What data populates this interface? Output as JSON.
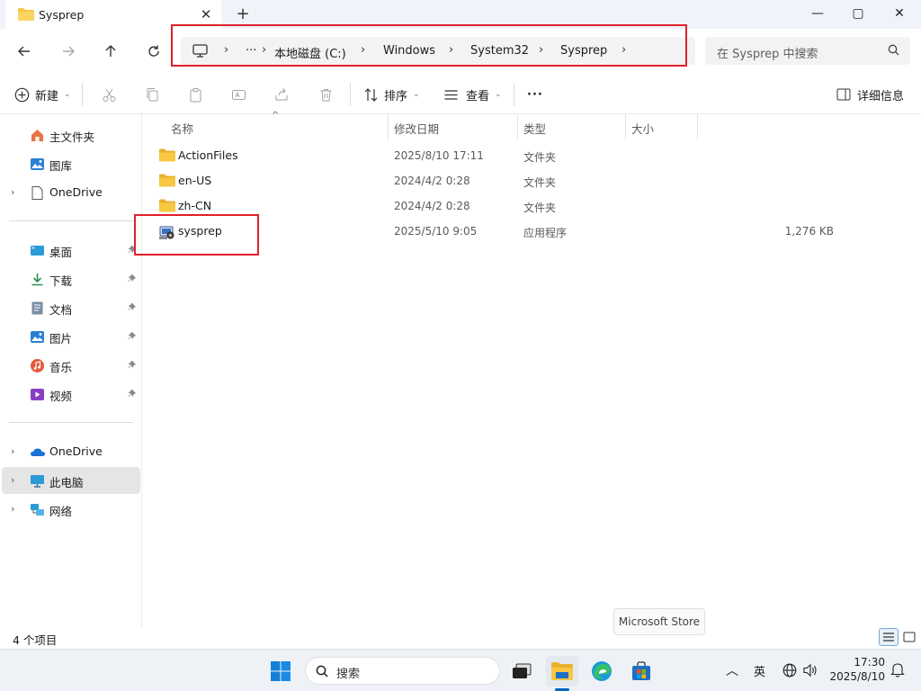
{
  "window": {
    "tab_title": "Sysprep",
    "new_tab_label": "+",
    "controls": {
      "minimize": "—",
      "maximize": "▢",
      "close": "✕"
    }
  },
  "address_bar": {
    "overflow": "···",
    "crumbs": [
      "本地磁盘 (C:)",
      "Windows",
      "System32",
      "Sysprep"
    ],
    "separator": "›"
  },
  "search": {
    "placeholder": "在 Sysprep 中搜索"
  },
  "command_bar": {
    "new_label": "新建",
    "sort_label": "排序",
    "view_label": "查看",
    "more_label": "···",
    "details_label": "详细信息"
  },
  "sidebar": {
    "home": "主文件夹",
    "gallery": "图库",
    "onedrive_top": "OneDrive",
    "quick_access": [
      "桌面",
      "下载",
      "文档",
      "图片",
      "音乐",
      "视频"
    ],
    "onedrive": "OneDrive",
    "this_pc": "此电脑",
    "network": "网络"
  },
  "columns": {
    "name": "名称",
    "modified": "修改日期",
    "type": "类型",
    "size": "大小"
  },
  "files": [
    {
      "name": "ActionFiles",
      "modified": "2025/8/10 17:11",
      "type": "文件夹",
      "size": "",
      "icon": "folder-icon"
    },
    {
      "name": "en-US",
      "modified": "2024/4/2 0:28",
      "type": "文件夹",
      "size": "",
      "icon": "folder-icon"
    },
    {
      "name": "zh-CN",
      "modified": "2024/4/2 0:28",
      "type": "文件夹",
      "size": "",
      "icon": "folder-icon"
    },
    {
      "name": "sysprep",
      "modified": "2025/5/10 9:05",
      "type": "应用程序",
      "size": "1,276 KB",
      "icon": "application-icon"
    }
  ],
  "status": {
    "item_count": "4 个项目"
  },
  "tooltip": "Microsoft Store",
  "taskbar": {
    "search_placeholder": "搜索",
    "ime": "英",
    "time": "17:30",
    "date": "2025/8/10"
  },
  "colors": {
    "highlight_box": "#e0202a",
    "accent": "#0067c0",
    "folder": "#f8c842"
  }
}
